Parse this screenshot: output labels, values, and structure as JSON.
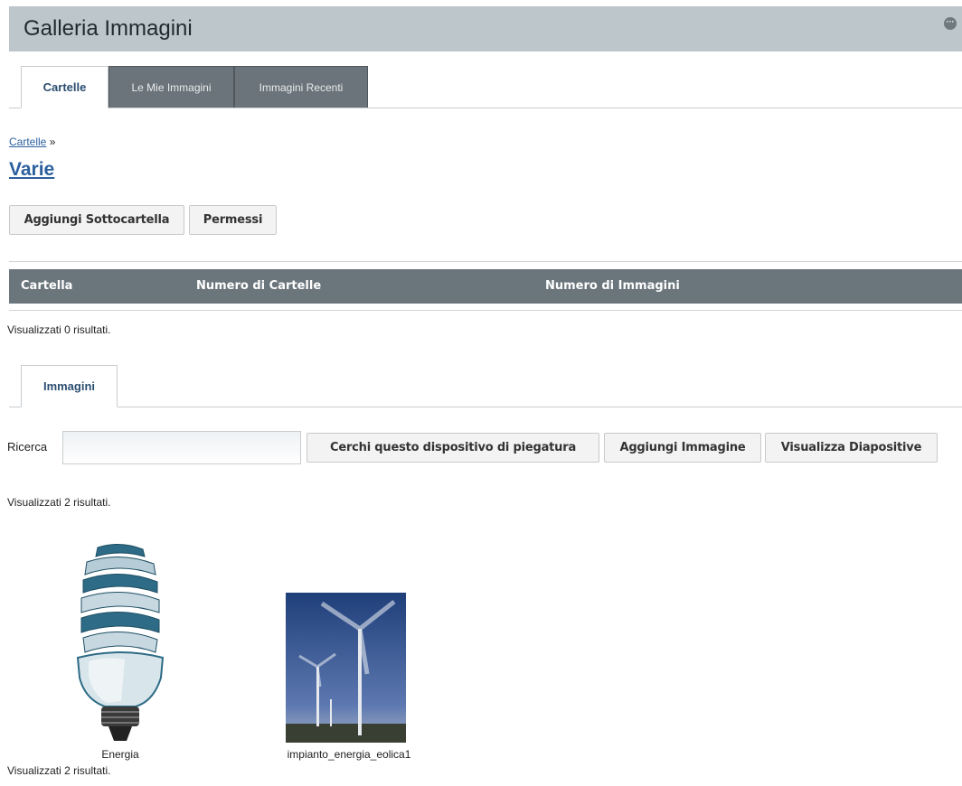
{
  "portlet": {
    "title": "Galleria Immagini",
    "options_icon": "options-icon"
  },
  "top_tabs": [
    "Cartelle",
    "Le Mie Immagini",
    "Immagini Recenti"
  ],
  "breadcrumb": {
    "link": "Cartelle",
    "separator": "»"
  },
  "folder": {
    "name": "Varie"
  },
  "folder_actions": {
    "add_subfolder": "Aggiungi Sottocartella",
    "permissions": "Permessi"
  },
  "folders_table": {
    "columns": [
      "Cartella",
      "Numero di Cartelle",
      "Numero di Immagini"
    ],
    "status": "Visualizzati 0 risultati."
  },
  "images_tab": {
    "label": "Immagini"
  },
  "search": {
    "label": "Ricerca",
    "value": "",
    "search_button": "Cerchi questo dispositivo di piegatura",
    "add_image_button": "Aggiungi Immagine",
    "slideshow_button": "Visualizza Diapositive"
  },
  "images": {
    "status_top": "Visualizzati 2 risultati.",
    "items": [
      {
        "caption": "Energia",
        "icon": "light-bulb-icon"
      },
      {
        "caption": "impianto_energia_eolica1",
        "icon": "wind-turbine-photo"
      }
    ],
    "status_bottom": "Visualizzati 2 risultati."
  }
}
